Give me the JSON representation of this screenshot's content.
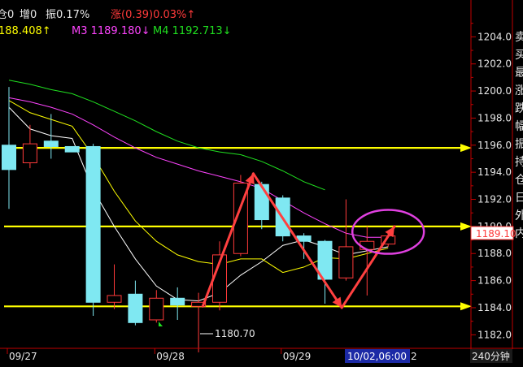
{
  "header": {
    "seg_pos": "仓0",
    "seg_zeng": "增0",
    "seg_zhen": "振0.17%",
    "seg_zhang": "涨(0.39)0.03%↑",
    "ma2": "188.408↑",
    "ma3": "M3  1189.180↓",
    "ma4": "M4  1192.713↓",
    "colors": {
      "white": "#e8e8e8",
      "red": "#ff3a3a",
      "yellow": "#ffff00",
      "magenta": "#ff44ff",
      "green": "#20e020"
    }
  },
  "right_edge_chars": [
    "卖",
    "买",
    "最",
    "涨",
    "跌",
    "幅",
    "振",
    "持",
    "仓",
    "日",
    "外",
    "内"
  ],
  "price_tag": "1189.10",
  "low_label": "1180.70",
  "footer": {
    "date1": "09/27",
    "date2": "09/28",
    "date3": "09/29",
    "cursor_date": "10/02,06:00",
    "trail": "2",
    "period": "240分钟"
  },
  "chart_data": {
    "type": "candlestick",
    "ylim": [
      1181,
      1206
    ],
    "yticks": [
      1182,
      1184,
      1186,
      1188,
      1190,
      1192,
      1194,
      1196,
      1198,
      1200,
      1202,
      1204
    ],
    "dates": [
      {
        "label": "09/27",
        "at_candle": 0
      },
      {
        "label": "09/28",
        "at_candle": 7
      },
      {
        "label": "09/29",
        "at_candle": 13
      }
    ],
    "candles": [
      {
        "open": 1196.0,
        "close": 1194.2,
        "high": 1200.3,
        "low": 1191.3
      },
      {
        "open": 1194.7,
        "close": 1196.1,
        "high": 1197.5,
        "low": 1194.3
      },
      {
        "open": 1196.3,
        "close": 1195.9,
        "high": 1198.3,
        "low": 1195.0
      },
      {
        "open": 1195.9,
        "close": 1195.5,
        "high": 1195.9,
        "low": 1195.5
      },
      {
        "open": 1195.9,
        "close": 1184.4,
        "high": 1196.1,
        "low": 1183.4
      },
      {
        "open": 1184.4,
        "close": 1184.9,
        "high": 1187.2,
        "low": 1183.9
      },
      {
        "open": 1185.0,
        "close": 1182.9,
        "high": 1186.0,
        "low": 1182.7
      },
      {
        "open": 1183.1,
        "close": 1184.7,
        "high": 1185.3,
        "low": 1182.9
      },
      {
        "open": 1184.7,
        "close": 1184.2,
        "high": 1185.5,
        "low": 1183.1
      },
      {
        "open": 1184.1,
        "close": 1184.4,
        "high": 1185.1,
        "low": 1180.7
      },
      {
        "open": 1184.4,
        "close": 1187.9,
        "high": 1188.9,
        "low": 1183.8
      },
      {
        "open": 1188.0,
        "close": 1193.2,
        "high": 1193.8,
        "low": 1187.8
      },
      {
        "open": 1193.1,
        "close": 1190.5,
        "high": 1193.3,
        "low": 1189.8
      },
      {
        "open": 1192.1,
        "close": 1189.3,
        "high": 1192.3,
        "low": 1188.9
      },
      {
        "open": 1189.3,
        "close": 1188.9,
        "high": 1189.5,
        "low": 1187.6
      },
      {
        "open": 1188.9,
        "close": 1186.1,
        "high": 1189.0,
        "low": 1184.3
      },
      {
        "open": 1186.2,
        "close": 1188.5,
        "high": 1192.0,
        "low": 1186.0
      },
      {
        "open": 1188.3,
        "close": 1188.9,
        "high": 1190.0,
        "low": 1184.9
      },
      {
        "open": 1188.7,
        "close": 1189.3,
        "high": 1189.7,
        "low": 1188.5
      }
    ],
    "ma_lines": [
      {
        "name": "M1",
        "color": "#ffffff",
        "values": [
          1198.8,
          1197.2,
          1196.7,
          1196.5,
          1192.7,
          1190.0,
          1187.6,
          1185.6,
          1184.6,
          1184.5,
          1185.1,
          1186.4,
          1187.4,
          1188.6,
          1189.0,
          1188.5,
          1187.9,
          1188.2,
          1188.5
        ]
      },
      {
        "name": "M2",
        "color": "#ffff00",
        "values": [
          1199.3,
          1198.4,
          1197.9,
          1197.4,
          1195.2,
          1192.6,
          1190.4,
          1188.9,
          1187.9,
          1187.4,
          1187.2,
          1187.6,
          1187.6,
          1186.6,
          1187.0,
          1187.7,
          1187.6,
          1188.0,
          1188.4
        ]
      },
      {
        "name": "M3",
        "color": "#ff44ff",
        "values": [
          1199.5,
          1199.2,
          1198.8,
          1198.3,
          1197.5,
          1196.6,
          1195.8,
          1195.1,
          1194.6,
          1194.1,
          1193.7,
          1193.3,
          1192.8,
          1191.9,
          1191.0,
          1190.2,
          1189.5,
          1189.2,
          1189.2
        ]
      },
      {
        "name": "M4",
        "color": "#20e020",
        "values": [
          1200.8,
          1200.5,
          1200.1,
          1199.8,
          1199.2,
          1198.5,
          1197.8,
          1197.0,
          1196.3,
          1195.8,
          1195.5,
          1195.3,
          1194.8,
          1194.1,
          1193.3,
          1192.7
        ]
      }
    ],
    "annotations": {
      "horizontal_lines": [
        1195.8,
        1190.0,
        1184.1
      ],
      "zigzag": [
        {
          "candle": 9.2,
          "price": 1184.1
        },
        {
          "candle": 11.6,
          "price": 1193.9
        },
        {
          "candle": 15.8,
          "price": 1184.0
        },
        {
          "candle": 18.3,
          "price": 1190.0
        }
      ],
      "ellipse": {
        "candle": 18.0,
        "price": 1189.6
      }
    }
  }
}
